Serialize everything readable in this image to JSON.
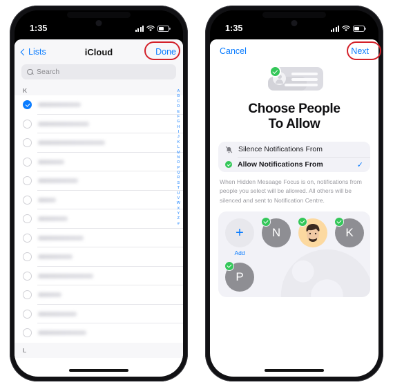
{
  "left_phone": {
    "status_bar": {
      "time": "1:35",
      "signal": "signal-bars-icon",
      "wifi": "wifi-icon",
      "battery": "battery-icon"
    },
    "nav": {
      "back_label": "Lists",
      "title": "iCloud",
      "done_label": "Done"
    },
    "search": {
      "placeholder": "Search",
      "icon": "search-icon"
    },
    "section_header_top": "K",
    "section_header_bottom": "L",
    "rows": [
      {
        "checked": true,
        "width": 62
      },
      {
        "checked": false,
        "width": 74
      },
      {
        "checked": false,
        "width": 97
      },
      {
        "checked": false,
        "width": 38
      },
      {
        "checked": false,
        "width": 58
      },
      {
        "checked": false,
        "width": 26
      },
      {
        "checked": false,
        "width": 43
      },
      {
        "checked": false,
        "width": 66
      },
      {
        "checked": false,
        "width": 50
      },
      {
        "checked": false,
        "width": 80
      },
      {
        "checked": false,
        "width": 34
      },
      {
        "checked": false,
        "width": 56
      },
      {
        "checked": false,
        "width": 70
      }
    ],
    "alphabet_index": [
      "A",
      "B",
      "C",
      "D",
      "E",
      "F",
      "G",
      "H",
      "I",
      "J",
      "K",
      "L",
      "M",
      "N",
      "O",
      "P",
      "Q",
      "R",
      "S",
      "T",
      "U",
      "V",
      "W",
      "X",
      "Y",
      "Z",
      "#"
    ]
  },
  "right_phone": {
    "status_bar": {
      "time": "1:35",
      "signal": "signal-bars-icon",
      "wifi": "wifi-icon",
      "battery": "battery-icon"
    },
    "nav": {
      "cancel_label": "Cancel",
      "next_label": "Next"
    },
    "hero": {
      "icon": "message-bubbles-check-icon",
      "title_line1": "Choose People",
      "title_line2": "To Allow"
    },
    "options": [
      {
        "label": "Silence Notifications From",
        "icon": "bell-slash-icon",
        "selected": false,
        "check": ""
      },
      {
        "label": "Allow Notifications From",
        "icon": "green-check-icon",
        "selected": true,
        "check": "✓"
      }
    ],
    "description": "When Hidden Mesaage Focus is on, notifications from people you select will be allowed. All others will be silenced and sent to Notification Centre.",
    "people": [
      {
        "initial": "+",
        "label": "Add",
        "type": "add",
        "badge": false
      },
      {
        "initial": "N",
        "label": "",
        "type": "letter",
        "badge": true
      },
      {
        "initial": "",
        "label": "",
        "type": "memoji",
        "badge": true
      },
      {
        "initial": "K",
        "label": "",
        "type": "letter",
        "badge": true
      },
      {
        "initial": "P",
        "label": "",
        "type": "letter",
        "badge": true
      }
    ]
  },
  "annotations": {
    "color": "#d32029",
    "targets": [
      "done-button",
      "next-button"
    ]
  }
}
